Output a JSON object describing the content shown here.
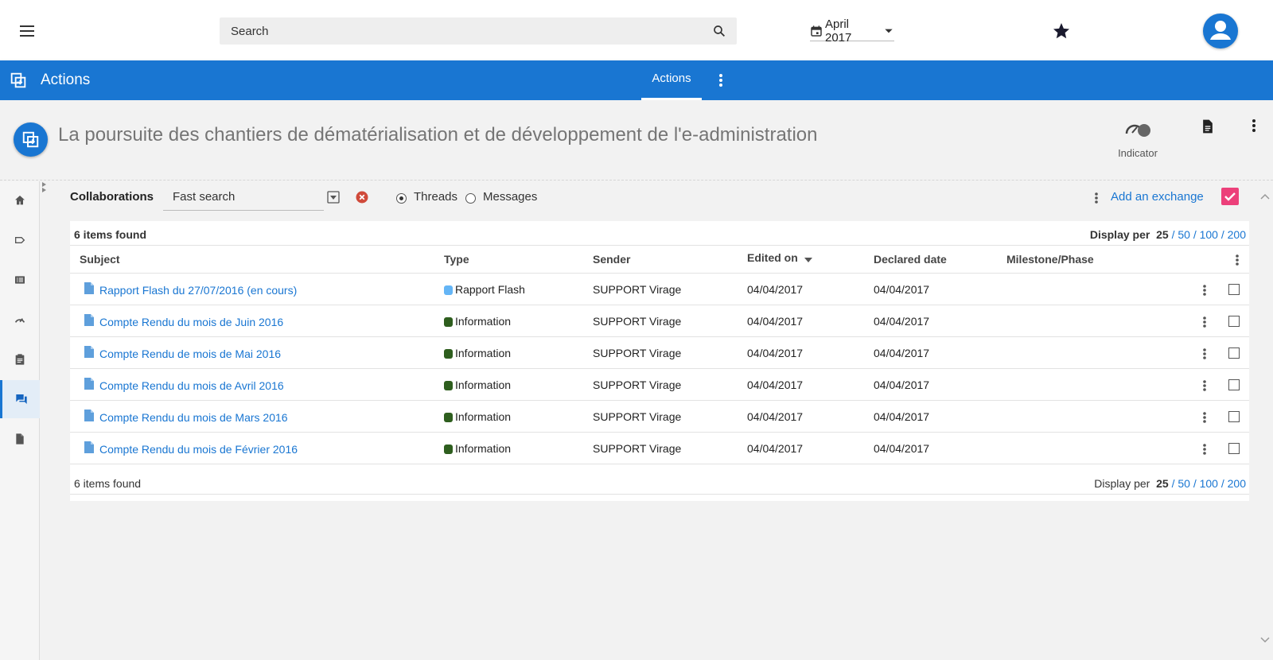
{
  "topbar": {
    "search_placeholder": "Search",
    "date_label": "April 2017"
  },
  "appbar": {
    "title": "Actions",
    "active_tab": "Actions",
    "color": "#1976d2"
  },
  "page_header": {
    "title": "La poursuite des chantiers de dématérialisation et de développement de l'e-administration",
    "indicator_label": "Indicator"
  },
  "leftnav": {
    "items": [
      {
        "icon": "home-icon",
        "active": false
      },
      {
        "icon": "label-icon",
        "active": false
      },
      {
        "icon": "list-icon",
        "active": false
      },
      {
        "icon": "speedometer-icon",
        "active": false
      },
      {
        "icon": "clipboard-icon",
        "active": false
      },
      {
        "icon": "chat-icon",
        "active": true
      },
      {
        "icon": "document-icon",
        "active": false
      }
    ]
  },
  "toolbar": {
    "label": "Collaborations",
    "fast_search_placeholder": "Fast search",
    "radio_threads": "Threads",
    "radio_messages": "Messages",
    "selected_radio": "Threads",
    "add_exchange": "Add an exchange"
  },
  "table": {
    "items_found": "6 items found",
    "display_per_label": "Display per",
    "page_sizes": [
      "25",
      "50",
      "100",
      "200"
    ],
    "selected_page_size": "25",
    "columns": {
      "subject": "Subject",
      "type": "Type",
      "sender": "Sender",
      "edited_on": "Edited on",
      "declared_date": "Declared date",
      "milestone": "Milestone/Phase"
    },
    "rows": [
      {
        "subject": "Rapport Flash du 27/07/2016 (en cours)",
        "type": "Rapport Flash",
        "type_color": "#64b5f6",
        "sender": "SUPPORT Virage",
        "edited_on": "04/04/2017",
        "declared_date": "04/04/2017",
        "milestone": ""
      },
      {
        "subject": "Compte Rendu du mois de Juin 2016",
        "type": "Information",
        "type_color": "#2e5e1e",
        "sender": "SUPPORT Virage",
        "edited_on": "04/04/2017",
        "declared_date": "04/04/2017",
        "milestone": ""
      },
      {
        "subject": "Compte Rendu de mois de Mai 2016",
        "type": "Information",
        "type_color": "#2e5e1e",
        "sender": "SUPPORT Virage",
        "edited_on": "04/04/2017",
        "declared_date": "04/04/2017",
        "milestone": ""
      },
      {
        "subject": "Compte Rendu du mois de Avril 2016",
        "type": "Information",
        "type_color": "#2e5e1e",
        "sender": "SUPPORT Virage",
        "edited_on": "04/04/2017",
        "declared_date": "04/04/2017",
        "milestone": ""
      },
      {
        "subject": "Compte Rendu du mois de Mars 2016",
        "type": "Information",
        "type_color": "#2e5e1e",
        "sender": "SUPPORT Virage",
        "edited_on": "04/04/2017",
        "declared_date": "04/04/2017",
        "milestone": ""
      },
      {
        "subject": "Compte Rendu du mois de Février 2016",
        "type": "Information",
        "type_color": "#2e5e1e",
        "sender": "SUPPORT Virage",
        "edited_on": "04/04/2017",
        "declared_date": "04/04/2017",
        "milestone": ""
      }
    ]
  }
}
